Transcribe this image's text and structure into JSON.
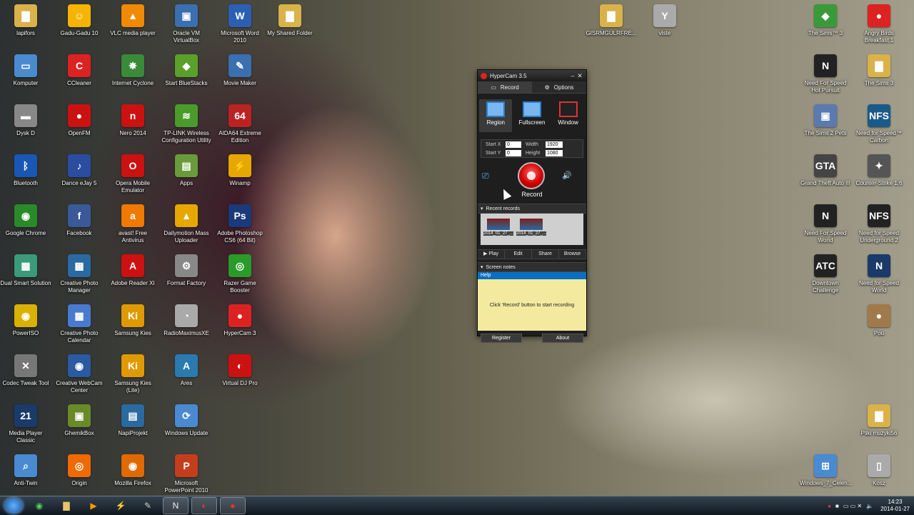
{
  "desktop_icons": [
    {
      "label": "lapifors",
      "color": "#d9b24a",
      "glyph": "▇"
    },
    {
      "label": "Gadu-Gadu 10",
      "color": "#f5b400",
      "glyph": "☺"
    },
    {
      "label": "VLC media player",
      "color": "#f08a00",
      "glyph": "▲"
    },
    {
      "label": "Oracle VM VirtualBox",
      "color": "#3a6fb0",
      "glyph": "▣"
    },
    {
      "label": "Microsoft Word 2010",
      "color": "#2b5fb3",
      "glyph": "W"
    },
    {
      "label": "My Shared Folder",
      "color": "#d9b24a",
      "glyph": "▇"
    },
    {
      "label": "Komputer",
      "color": "#4a8bd0",
      "glyph": "▭"
    },
    {
      "label": "CCleaner",
      "color": "#d22",
      "glyph": "C"
    },
    {
      "label": "Internet Cyclone",
      "color": "#3a8a3a",
      "glyph": "✸"
    },
    {
      "label": "Start BlueStacks",
      "color": "#5aa02a",
      "glyph": "◆"
    },
    {
      "label": "Movie Maker",
      "color": "#3a6fb0",
      "glyph": "✎"
    },
    {
      "label": "Dysk D",
      "color": "#888",
      "glyph": "▬"
    },
    {
      "label": "OpenFM",
      "color": "#c11",
      "glyph": "●"
    },
    {
      "label": "Nero 2014",
      "color": "#c11",
      "glyph": "n"
    },
    {
      "label": "TP-LINK Wireless Configuration Utility",
      "color": "#4a9b2a",
      "glyph": "≋"
    },
    {
      "label": "AIDA64 Extreme Edition",
      "color": "#b22",
      "glyph": "64"
    },
    {
      "label": "Bluetooth",
      "color": "#1a57b5",
      "glyph": "ᛒ"
    },
    {
      "label": "Dance eJay 5",
      "color": "#2a4da0",
      "glyph": "♪"
    },
    {
      "label": "Opera Mobile Emulator",
      "color": "#c11",
      "glyph": "O"
    },
    {
      "label": "Apps",
      "color": "#6a9b3a",
      "glyph": "▤"
    },
    {
      "label": "Winamp",
      "color": "#e6a800",
      "glyph": "⚡"
    },
    {
      "label": "Google Chrome",
      "color": "#2a8a2a",
      "glyph": "◉"
    },
    {
      "label": "Facebook",
      "color": "#3b5998",
      "glyph": "f"
    },
    {
      "label": "avast! Free Antivirus",
      "color": "#f07a00",
      "glyph": "a"
    },
    {
      "label": "Dailymotion Mass Uploader",
      "color": "#e6a800",
      "glyph": "▲"
    },
    {
      "label": "Adobe Photoshop CS6 (64 Bit)",
      "color": "#1a3a7a",
      "glyph": "Ps"
    },
    {
      "label": "Dual Smart Solution",
      "color": "#3a9a7a",
      "glyph": "▦"
    },
    {
      "label": "Creative Photo Manager",
      "color": "#2a6aa0",
      "glyph": "▩"
    },
    {
      "label": "Adobe Reader XI",
      "color": "#c11",
      "glyph": "A"
    },
    {
      "label": "Format Factory",
      "color": "#888",
      "glyph": "⚙"
    },
    {
      "label": "Razer Game Booster",
      "color": "#2a9a2a",
      "glyph": "◎"
    },
    {
      "label": "PowerISO",
      "color": "#d9b200",
      "glyph": "◉"
    },
    {
      "label": "Creative Photo Calendar",
      "color": "#4a7ad0",
      "glyph": "▦"
    },
    {
      "label": "Samsung Kies",
      "color": "#e09a00",
      "glyph": "Ki"
    },
    {
      "label": "RadioMaximusXE",
      "color": "#aaa",
      "glyph": "◔"
    },
    {
      "label": "HyperCam 3",
      "color": "#d22",
      "glyph": "●"
    },
    {
      "label": "Codec Tweak Tool",
      "color": "#777",
      "glyph": "✕"
    },
    {
      "label": "Creative WebCam Center",
      "color": "#2a5aa0",
      "glyph": "◉"
    },
    {
      "label": "Samsung Kies (Lite)",
      "color": "#e09a00",
      "glyph": "Ki"
    },
    {
      "label": "Ares",
      "color": "#2a7ab0",
      "glyph": "A"
    },
    {
      "label": "Virtual DJ Pro",
      "color": "#c11",
      "glyph": "◐"
    },
    {
      "label": "Media Player Classic",
      "color": "#1a3a6a",
      "glyph": "21"
    },
    {
      "label": "GhemikBox",
      "color": "#6a8a2a",
      "glyph": "▣"
    },
    {
      "label": "NapiProjekt",
      "color": "#2a6aa0",
      "glyph": "▤"
    },
    {
      "label": "Windows Update",
      "color": "#4a8ad0",
      "glyph": "⟳"
    },
    {
      "label": "Anti-Twin",
      "color": "#4a8ad0",
      "glyph": "⌕"
    },
    {
      "label": "Origin",
      "color": "#f06a00",
      "glyph": "◎"
    },
    {
      "label": "Mozilla Firefox",
      "color": "#e06a00",
      "glyph": "◉"
    },
    {
      "label": "Microsoft PowerPoint 2010",
      "color": "#c43e1c",
      "glyph": "P"
    },
    {
      "label": "GISRMGULRFRE...",
      "color": "#d9b24a",
      "glyph": "▇"
    },
    {
      "label": "vlste",
      "color": "#aaa",
      "glyph": "Y"
    },
    {
      "label": "The Sims™ 3",
      "color": "#3a9a3a",
      "glyph": "◆"
    },
    {
      "label": "Angry Birds Breakfast 1",
      "color": "#d22",
      "glyph": "●"
    },
    {
      "label": "Need For Speed Hot Pursuit",
      "color": "#222",
      "glyph": "N"
    },
    {
      "label": "The Sims 3",
      "color": "#d9b24a",
      "glyph": "▇"
    },
    {
      "label": "The Sims 2 Pets",
      "color": "#5a7ab0",
      "glyph": "▣"
    },
    {
      "label": "Need for Speed™ Carbon",
      "color": "#1a5a8a",
      "glyph": "NFS"
    },
    {
      "label": "Grand Theft Auto III",
      "color": "#444",
      "glyph": "GTA"
    },
    {
      "label": "Counter-Strike 1.6",
      "color": "#555",
      "glyph": "✦"
    },
    {
      "label": "Need For Speed World",
      "color": "#222",
      "glyph": "N"
    },
    {
      "label": "Need for Speed Underground 2",
      "color": "#222",
      "glyph": "NFS"
    },
    {
      "label": "Downtown Challenge",
      "color": "#222",
      "glyph": "ATC"
    },
    {
      "label": "Need for Speed World",
      "color": "#1a3a6a",
      "glyph": "N"
    },
    {
      "label": "Pou",
      "color": "#a07a4a",
      "glyph": "●"
    },
    {
      "label": "Pliki muzyki56",
      "color": "#d9b24a",
      "glyph": "▇"
    },
    {
      "label": "Windows_7_Celen...",
      "color": "#4a8ad0",
      "glyph": "⊞"
    },
    {
      "label": "Kosz",
      "color": "#aaa",
      "glyph": "▯"
    }
  ],
  "hypercam": {
    "title": "HyperCam 3.5",
    "tabs": [
      "Record",
      "Options"
    ],
    "modes": [
      "Region",
      "Fullscreen",
      "Window"
    ],
    "start_x_label": "Start X",
    "start_x": "0",
    "start_y_label": "Start Y",
    "start_y": "0",
    "width_label": "Width",
    "width": "1920",
    "height_label": "Height",
    "height": "1080",
    "record_label": "Record",
    "recent_label": "Recent records",
    "recent_items": [
      "2014_01_27_...",
      "2014_01_27_..."
    ],
    "actions": [
      "▶ Play",
      "Edit",
      "Share",
      "Browse"
    ],
    "screen_notes_label": "Screen notes",
    "help_label": "Help",
    "notes_text": "Click 'Record' button to start recording",
    "register_label": "Register",
    "about_label": "About"
  },
  "taskbar": {
    "buttons": [
      "ie",
      "chrome",
      "explorer",
      "media",
      "winamp",
      "pen",
      "nfs",
      "razer",
      "hypercam"
    ],
    "clock_time": "14:23",
    "clock_date": "2014-01-27"
  }
}
